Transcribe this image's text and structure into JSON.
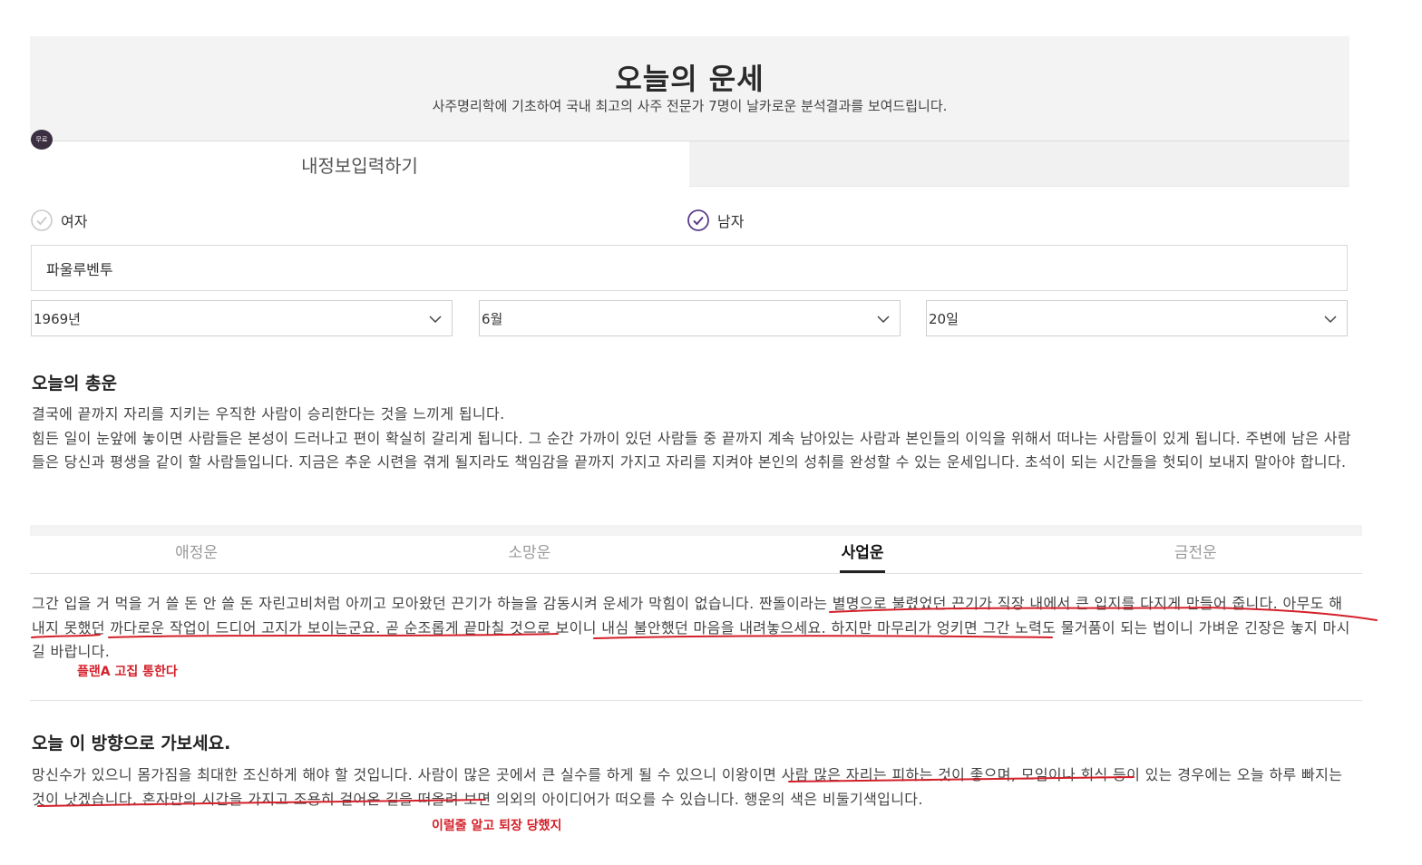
{
  "header": {
    "title": "오늘의 운세",
    "subtitle": "사주명리학에 기초하여 국내 최고의 사주 전문가 7명이 날카로운 분석결과를 보여드립니다."
  },
  "badge": {
    "text": "무료"
  },
  "input_tab": {
    "label": "내정보입력하기"
  },
  "gender": {
    "female_label": "여자",
    "male_label": "남자",
    "selected": "남자"
  },
  "name_input": {
    "value": "파울루벤투"
  },
  "selects": {
    "year": "1969년",
    "month": "6월",
    "day": "20일"
  },
  "overall": {
    "title": "오늘의 총운",
    "line1": "결국에 끝까지 자리를 지키는 우직한 사람이 승리한다는 것을 느끼게 됩니다.",
    "line2": "힘든 일이 눈앞에 놓이면 사람들은 본성이 드러나고 편이 확실히 갈리게 됩니다. 그 순간 가까이 있던 사람들 중 끝까지 계속 남아있는 사람과 본인들의 이익을 위해서 떠나는 사람들이 있게 됩니다. 주변에 남은 사람들은 당신과 평생을 같이 할 사람들입니다. 지금은 추운 시련을 겪게 될지라도 책임감을 끝까지 가지고 자리를 지켜야 본인의 성취를 완성할 수 있는 운세입니다. 초석이 되는 시간들을 헛되이 보내지 말아야 합니다."
  },
  "fortune_tabs": [
    {
      "label": "애정운"
    },
    {
      "label": "소망운"
    },
    {
      "label": "사업운"
    },
    {
      "label": "금전운"
    }
  ],
  "business": {
    "text": "그간 입을 거 먹을 거 쓸 돈 안 쓸 돈 자린고비처럼 아끼고 모아왔던 끈기가 하늘을 감동시켜 운세가 막힘이 없습니다. 짠돌이라는 별명으로 불렸었던 끈기가 직장 내에서 큰 입지를 다지게 만들어 줍니다. 아무도 해내지 못했던 까다로운 작업이 드디어 고지가 보이는군요. 곧 순조롭게 끝마칠 것으로 보이니 내심 불안했던 마음을 내려놓으세요. 하지만 마무리가 엉키면 그간 노력도 물거품이 되는 법이니 가벼운 긴장은 놓지 마시길 바랍니다."
  },
  "annotations": {
    "note1": "플랜A 고집 통한다",
    "note2": "이럴줄 알고 퇴장 당했지"
  },
  "direction": {
    "title": "오늘 이 방향으로 가보세요.",
    "text": "망신수가 있으니 몸가짐을 최대한 조신하게 해야 할 것입니다. 사람이 많은 곳에서 큰 실수를 하게 될 수 있으니 이왕이면 사람 많은 자리는 피하는 것이 좋으며, 모임이나 회식 등이 있는 경우에는 오늘 하루 빠지는 것이 낫겠습니다. 혼자만의 시간을 가지고 조용히 걸어온 길을 떠올려 보면 의외의 아이디어가 떠오를 수 있습니다. 행운의 색은 비둘기색입니다."
  },
  "colors": {
    "accent_purple": "#5a3d8a",
    "annotation_red": "#d4202a"
  }
}
